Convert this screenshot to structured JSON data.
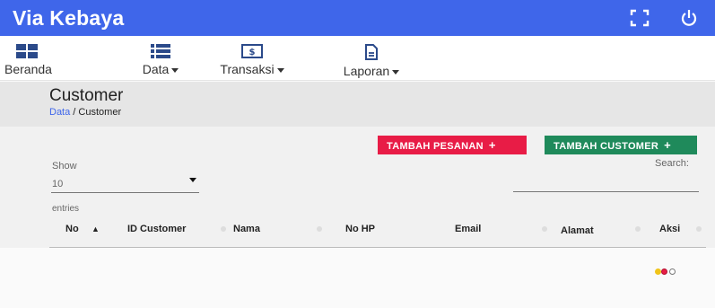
{
  "app": {
    "title": "Via Kebaya"
  },
  "topbar_icons": [
    "fullscreen-icon",
    "power-icon"
  ],
  "nav": {
    "beranda": "Beranda",
    "data": "Data",
    "transaksi": "Transaksi",
    "laporan": "Laporan"
  },
  "page": {
    "title": "Customer",
    "breadcrumb_link": "Data",
    "breadcrumb_sep": " / ",
    "breadcrumb_current": "Customer"
  },
  "buttons": {
    "tambah_pesanan": "TAMBAH PESANAN",
    "tambah_customer": "TAMBAH CUSTOMER",
    "plus": "+"
  },
  "table_controls": {
    "show_label": "Show",
    "show_value": "10",
    "entries_label": "entries",
    "search_label": "Search:"
  },
  "table": {
    "columns": [
      "No",
      "ID Customer",
      "Nama",
      "No HP",
      "Email",
      "Alamat",
      "Aksi"
    ]
  },
  "colors": {
    "primary": "#3f66ea",
    "danger": "#e81c46",
    "success": "#1f8a5b"
  }
}
